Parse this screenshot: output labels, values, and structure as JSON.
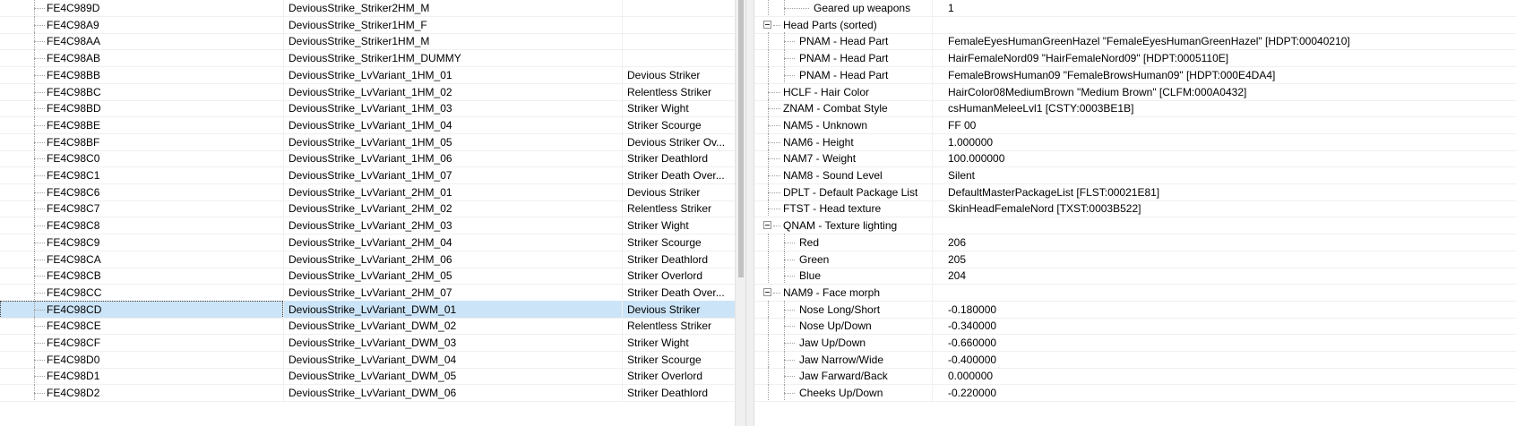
{
  "record_list": {
    "rows": [
      {
        "formid": "FE4C989D",
        "editor_id": "DeviousStrike_Striker2HM_M",
        "name": ""
      },
      {
        "formid": "FE4C98A9",
        "editor_id": "DeviousStrike_Striker1HM_F",
        "name": ""
      },
      {
        "formid": "FE4C98AA",
        "editor_id": "DeviousStrike_Striker1HM_M",
        "name": ""
      },
      {
        "formid": "FE4C98AB",
        "editor_id": "DeviousStrike_Striker1HM_DUMMY",
        "name": ""
      },
      {
        "formid": "FE4C98BB",
        "editor_id": "DeviousStrike_LvVariant_1HM_01",
        "name": "Devious Striker"
      },
      {
        "formid": "FE4C98BC",
        "editor_id": "DeviousStrike_LvVariant_1HM_02",
        "name": "Relentless Striker"
      },
      {
        "formid": "FE4C98BD",
        "editor_id": "DeviousStrike_LvVariant_1HM_03",
        "name": "Striker Wight"
      },
      {
        "formid": "FE4C98BE",
        "editor_id": "DeviousStrike_LvVariant_1HM_04",
        "name": "Striker Scourge"
      },
      {
        "formid": "FE4C98BF",
        "editor_id": "DeviousStrike_LvVariant_1HM_05",
        "name": "Devious Striker Ov..."
      },
      {
        "formid": "FE4C98C0",
        "editor_id": "DeviousStrike_LvVariant_1HM_06",
        "name": "Striker Deathlord"
      },
      {
        "formid": "FE4C98C1",
        "editor_id": "DeviousStrike_LvVariant_1HM_07",
        "name": "Striker Death Over..."
      },
      {
        "formid": "FE4C98C6",
        "editor_id": "DeviousStrike_LvVariant_2HM_01",
        "name": "Devious Striker"
      },
      {
        "formid": "FE4C98C7",
        "editor_id": "DeviousStrike_LvVariant_2HM_02",
        "name": "Relentless Striker"
      },
      {
        "formid": "FE4C98C8",
        "editor_id": "DeviousStrike_LvVariant_2HM_03",
        "name": "Striker Wight"
      },
      {
        "formid": "FE4C98C9",
        "editor_id": "DeviousStrike_LvVariant_2HM_04",
        "name": "Striker Scourge"
      },
      {
        "formid": "FE4C98CA",
        "editor_id": "DeviousStrike_LvVariant_2HM_06",
        "name": "Striker Deathlord"
      },
      {
        "formid": "FE4C98CB",
        "editor_id": "DeviousStrike_LvVariant_2HM_05",
        "name": "Striker Overlord"
      },
      {
        "formid": "FE4C98CC",
        "editor_id": "DeviousStrike_LvVariant_2HM_07",
        "name": "Striker Death Over..."
      },
      {
        "formid": "FE4C98CD",
        "editor_id": "DeviousStrike_LvVariant_DWM_01",
        "name": "Devious Striker",
        "selected": true
      },
      {
        "formid": "FE4C98CE",
        "editor_id": "DeviousStrike_LvVariant_DWM_02",
        "name": "Relentless Striker"
      },
      {
        "formid": "FE4C98CF",
        "editor_id": "DeviousStrike_LvVariant_DWM_03",
        "name": "Striker Wight"
      },
      {
        "formid": "FE4C98D0",
        "editor_id": "DeviousStrike_LvVariant_DWM_04",
        "name": "Striker Scourge"
      },
      {
        "formid": "FE4C98D1",
        "editor_id": "DeviousStrike_LvVariant_DWM_05",
        "name": "Striker Overlord"
      },
      {
        "formid": "FE4C98D2",
        "editor_id": "DeviousStrike_LvVariant_DWM_06",
        "name": "Striker Deathlord"
      }
    ]
  },
  "record_view": {
    "rows": [
      {
        "label": "Geared up weapons",
        "value": "1",
        "depth": 2,
        "expander": false
      },
      {
        "label": "Head Parts (sorted)",
        "value": "",
        "depth": 0,
        "expander": true
      },
      {
        "label": "PNAM - Head Part",
        "value": "FemaleEyesHumanGreenHazel \"FemaleEyesHumanGreenHazel\" [HDPT:00040210]",
        "depth": 1,
        "expander": false
      },
      {
        "label": "PNAM - Head Part",
        "value": "HairFemaleNord09 \"HairFemaleNord09\" [HDPT:0005110E]",
        "depth": 1,
        "expander": false
      },
      {
        "label": "PNAM - Head Part",
        "value": "FemaleBrowsHuman09 \"FemaleBrowsHuman09\" [HDPT:000E4DA4]",
        "depth": 1,
        "expander": false
      },
      {
        "label": "HCLF - Hair Color",
        "value": "HairColor08MediumBrown \"Medium Brown\" [CLFM:000A0432]",
        "depth": 0,
        "expander": false
      },
      {
        "label": "ZNAM - Combat Style",
        "value": "csHumanMeleeLvl1 [CSTY:0003BE1B]",
        "depth": 0,
        "expander": false
      },
      {
        "label": "NAM5 - Unknown",
        "value": "FF 00",
        "depth": 0,
        "expander": false
      },
      {
        "label": "NAM6 - Height",
        "value": "1.000000",
        "depth": 0,
        "expander": false
      },
      {
        "label": "NAM7 - Weight",
        "value": "100.000000",
        "depth": 0,
        "expander": false
      },
      {
        "label": "NAM8 - Sound Level",
        "value": "Silent",
        "depth": 0,
        "expander": false
      },
      {
        "label": "DPLT - Default Package List",
        "value": "DefaultMasterPackageList [FLST:00021E81]",
        "depth": 0,
        "expander": false
      },
      {
        "label": "FTST - Head texture",
        "value": "SkinHeadFemaleNord [TXST:0003B522]",
        "depth": 0,
        "expander": false
      },
      {
        "label": "QNAM - Texture lighting",
        "value": "",
        "depth": 0,
        "expander": true
      },
      {
        "label": "Red",
        "value": "206",
        "depth": 1,
        "expander": false
      },
      {
        "label": "Green",
        "value": "205",
        "depth": 1,
        "expander": false
      },
      {
        "label": "Blue",
        "value": "204",
        "depth": 1,
        "expander": false
      },
      {
        "label": "NAM9 - Face morph",
        "value": "",
        "depth": 0,
        "expander": true
      },
      {
        "label": "Nose Long/Short",
        "value": "-0.180000",
        "depth": 1,
        "expander": false
      },
      {
        "label": "Nose Up/Down",
        "value": "-0.340000",
        "depth": 1,
        "expander": false
      },
      {
        "label": "Jaw Up/Down",
        "value": "-0.660000",
        "depth": 1,
        "expander": false
      },
      {
        "label": "Jaw Narrow/Wide",
        "value": "-0.400000",
        "depth": 1,
        "expander": false
      },
      {
        "label": "Jaw Farward/Back",
        "value": "0.000000",
        "depth": 1,
        "expander": false
      },
      {
        "label": "Cheeks Up/Down",
        "value": "-0.220000",
        "depth": 1,
        "expander": false
      }
    ]
  },
  "colors": {
    "selection": "#cce4f7",
    "grid_line": "#f0f0f0",
    "tree_line": "#a0a0a0"
  }
}
